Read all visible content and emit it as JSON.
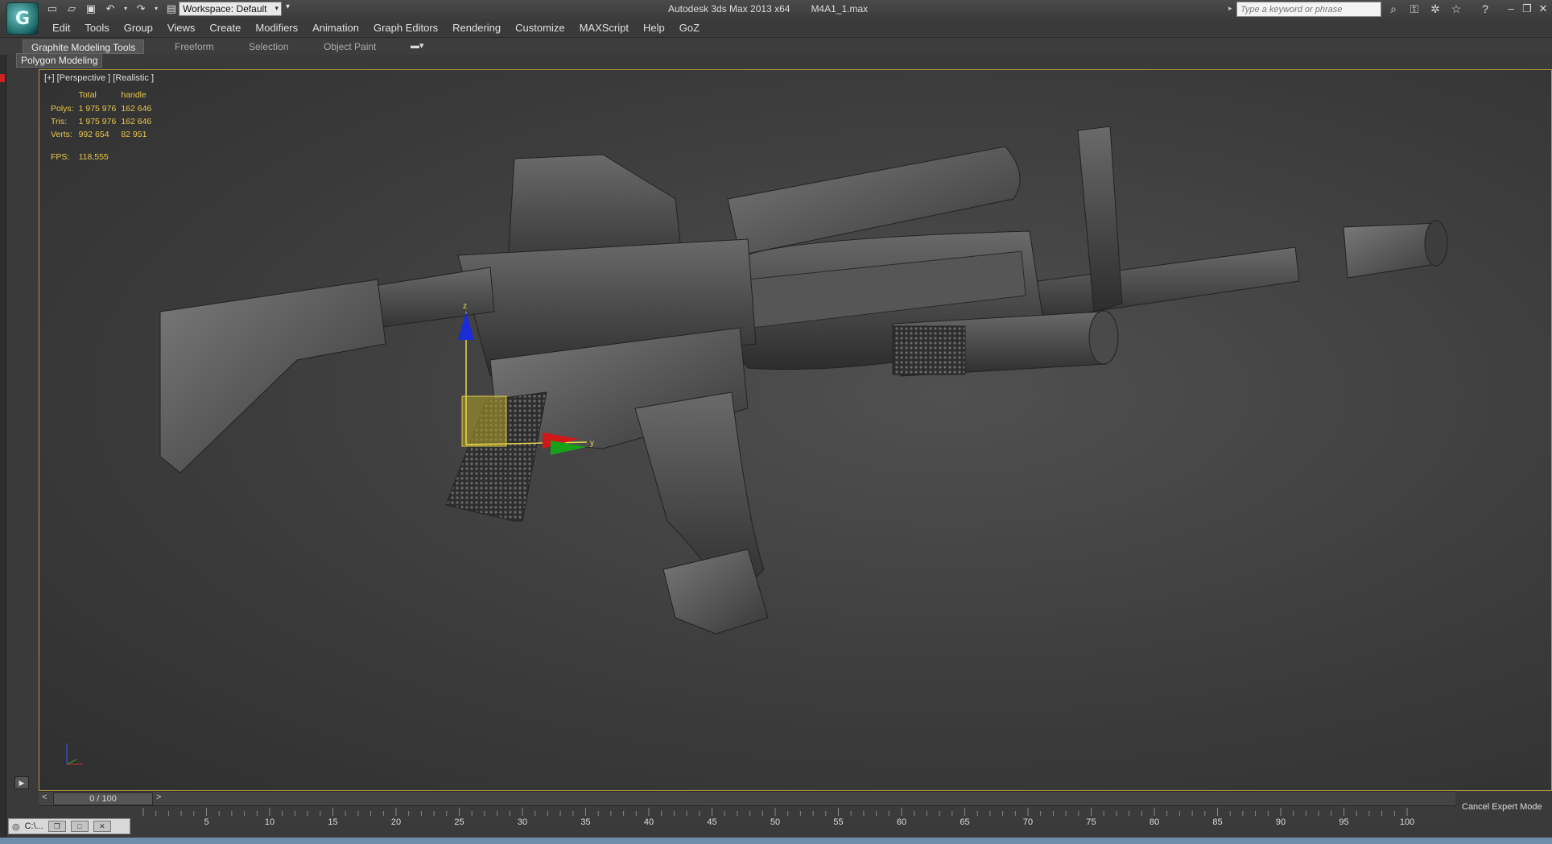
{
  "titlebar": {
    "app_title": "Autodesk 3ds Max  2013 x64",
    "file_name": "M4A1_1.max",
    "workspace_label": "Workspace: Default",
    "search_placeholder": "Type a keyword or phrase",
    "quick_access_icons": [
      "new-file-icon",
      "open-folder-icon",
      "save-icon",
      "undo-icon",
      "redo-icon",
      "project-icon"
    ],
    "help_icons": [
      "binoculars-icon",
      "key-icon",
      "satellite-icon",
      "star-icon",
      "help-icon"
    ]
  },
  "menu": {
    "items": [
      "Edit",
      "Tools",
      "Group",
      "Views",
      "Create",
      "Modifiers",
      "Animation",
      "Graph Editors",
      "Rendering",
      "Customize",
      "MAXScript",
      "Help",
      "GoZ"
    ]
  },
  "ribbon": {
    "tabs": [
      "Graphite Modeling Tools",
      "Freeform",
      "Selection",
      "Object Paint"
    ],
    "active_tab": "Graphite Modeling Tools",
    "panel_label": "Polygon Modeling"
  },
  "viewport": {
    "label": "[+] [Perspective ] [Realistic ]",
    "stats": {
      "col_total": "Total",
      "col_handle": "handle",
      "polys_label": "Polys:",
      "polys_total": "1 975 976",
      "polys_handle": "162 646",
      "tris_label": "Tris:",
      "tris_total": "1 975 976",
      "tris_handle": "162 646",
      "verts_label": "Verts:",
      "verts_total": "992 654",
      "verts_handle": "82 951",
      "fps_label": "FPS:",
      "fps_value": "118,555"
    },
    "gizmo_axes": [
      "z",
      "y"
    ]
  },
  "timeline": {
    "slider_label": "0 / 100",
    "prev": "<",
    "next": ">",
    "ticks": [
      "5",
      "10",
      "15",
      "20",
      "25",
      "30",
      "35",
      "40",
      "45",
      "50",
      "55",
      "60",
      "65",
      "70",
      "75",
      "80",
      "85",
      "90",
      "95",
      "100"
    ]
  },
  "status": {
    "cancel_expert": "Cancel Expert Mode",
    "minimized_window": "C:\\..."
  },
  "colors": {
    "viewport_border": "#b09a3a",
    "stats_text": "#e8c84a",
    "gizmo_z": "#1a2bd8",
    "gizmo_x": "#d01818",
    "gizmo_y": "#18a018"
  }
}
